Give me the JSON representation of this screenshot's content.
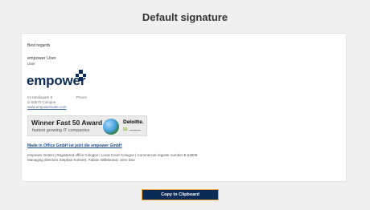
{
  "page": {
    "title": "Default signature"
  },
  "signature": {
    "greeting": "Best regards",
    "name": "empower User",
    "role": "User",
    "logo_text": "empower",
    "address_line1": "Im Mediapark 8",
    "phone_label": "Phone",
    "address_line2": "D-50670 Cologne",
    "website": "www.empowersuite.com",
    "banner": {
      "title": "Winner Fast 50 Award",
      "subtitle": "fastest growing IT companies",
      "brand": "Deloitte.",
      "badge": "50"
    },
    "made_in_office_link": "Made in Office GmbH ist jetzt die empower GmbH",
    "legal_line1": "empower GmbH | Registered office Cologne | Local Court Cologne | Commercial register number B 64808",
    "legal_line2": "Managing directors Stephan Kuhnert, Fabian Willebrand, John Doe"
  },
  "actions": {
    "copy_label": "Copy to Clipboard"
  },
  "colors": {
    "brand_navy": "#0b2b57",
    "button_border": "#f0a830",
    "deloitte_green": "#86bc25",
    "background": "#f0f0f0"
  },
  "icons": {
    "logo": "empower-logo-mark",
    "award": "award-globe-icon"
  }
}
